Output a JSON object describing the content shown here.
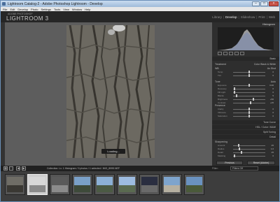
{
  "window": {
    "title": "Lightroom Catalog-2 - Adobe Photoshop Lightroom - Develop",
    "minimize": "–",
    "maximize": "□",
    "close": "×"
  },
  "menu": [
    "File",
    "Edit",
    "Develop",
    "Photo",
    "Settings",
    "Tools",
    "View",
    "Window",
    "Help"
  ],
  "identity": {
    "small": "ADOBE PHOTOSHOP",
    "logo": "LIGHTROOM 3"
  },
  "modules": [
    {
      "label": "Library",
      "active": false
    },
    {
      "label": "Develop",
      "active": true
    },
    {
      "label": "Slideshow",
      "active": false
    },
    {
      "label": "Print",
      "active": false
    },
    {
      "label": "Web",
      "active": false
    }
  ],
  "canvas": {
    "loading": "Loading..."
  },
  "right_panel": {
    "histogram_title": "Histogram",
    "basic_title": "Basic",
    "treatment": "Treatment",
    "treatment_options": "Color  Black & White",
    "wb": "WB",
    "wb_value": "As Shot",
    "tone": "Tone",
    "tone_auto": "Auto",
    "presence": "Presence",
    "tone_curve": "Tone Curve",
    "hsl": "HSL / Color / B&W",
    "split_toning": "Split Toning",
    "detail": "Detail",
    "sharpening": "Sharpening",
    "previous_button": "Previous",
    "reset_button": "Reset (Adobe)"
  },
  "sliders": [
    {
      "label": "Temp",
      "value": "0",
      "pos": 0.5
    },
    {
      "label": "Tint",
      "value": "0",
      "pos": 0.5
    },
    {
      "label": "Exposure",
      "value": "0.00",
      "pos": 0.5
    },
    {
      "label": "Recovery",
      "value": "0",
      "pos": 0.05
    },
    {
      "label": "Fill Light",
      "value": "0",
      "pos": 0.05
    },
    {
      "label": "Blacks",
      "value": "5",
      "pos": 0.1
    },
    {
      "label": "Brightness",
      "value": "+50",
      "pos": 0.62
    },
    {
      "label": "Contrast",
      "value": "+25",
      "pos": 0.55
    },
    {
      "label": "Clarity",
      "value": "0",
      "pos": 0.5
    },
    {
      "label": "Vibrance",
      "value": "0",
      "pos": 0.5
    },
    {
      "label": "Saturation",
      "value": "0",
      "pos": 0.5
    },
    {
      "label": "Amount",
      "value": "25",
      "pos": 0.17
    },
    {
      "label": "Radius",
      "value": "1.0",
      "pos": 0.2
    },
    {
      "label": "Detail",
      "value": "25",
      "pos": 0.25
    },
    {
      "label": "Masking",
      "value": "0",
      "pos": 0.05
    }
  ],
  "toolbar": {
    "source": "Collection: Lv. 1 Histogram / 9 photos / 1 selected / IMG_8995.NEF",
    "filter_label": "Filter:",
    "filter_value": "Filters Off"
  },
  "filmstrip": {
    "count": 9,
    "selected_index": 1
  },
  "colors": {
    "accent": "#cfcfcf",
    "panel": "#2e2e2e",
    "canvas": "#5d5d5d"
  }
}
